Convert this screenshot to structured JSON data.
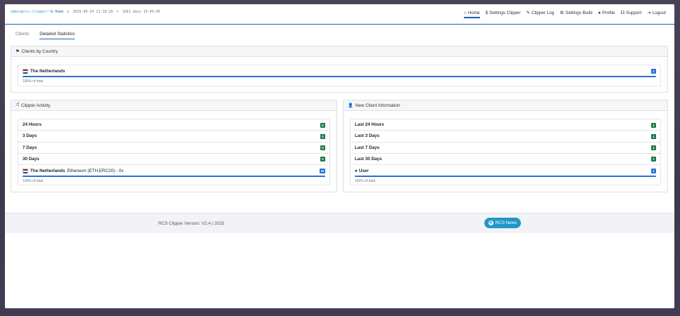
{
  "header": {
    "prompt_user": "admin@rcs-clipper",
    "prompt_path": ":~$ Home",
    "datetime": "2025-09-24 11:10:26",
    "uptime": "1681 days 15:45:45"
  },
  "nav": [
    {
      "icon": "home-icon",
      "label": "Home"
    },
    {
      "icon": "dollar-icon",
      "label": "Settings Clipper"
    },
    {
      "icon": "pencil-icon",
      "label": "Clipper Log"
    },
    {
      "icon": "gear-icon",
      "label": "Settings Build"
    },
    {
      "icon": "user-icon",
      "label": "Profile"
    },
    {
      "icon": "headset-icon",
      "label": "Support"
    },
    {
      "icon": "logout-icon",
      "label": "Logout"
    }
  ],
  "tabs": [
    "Clients",
    "Detailed Statistics"
  ],
  "countries": {
    "title": "Clients by Country",
    "country": "The Netherlands",
    "count": "1",
    "percent_text": "100% of total",
    "fill": 1.0
  },
  "activity": {
    "title": "Clipper Activity",
    "rows": [
      {
        "label": "24 Hours",
        "count": "0"
      },
      {
        "label": "3 Days",
        "count": "0"
      },
      {
        "label": "7 Days",
        "count": "0"
      },
      {
        "label": "30 Days",
        "count": "0"
      }
    ],
    "country": "The Netherlands",
    "detail": "Ethereum (ETH,ERC20) - 0x",
    "detail_count": "32",
    "percent_text": "100% of total",
    "fill": 1.0
  },
  "new_clients": {
    "title": "New Client Information",
    "rows": [
      {
        "label": "Last 24 Hours",
        "count": "1"
      },
      {
        "label": "Last 3 Days",
        "count": "1"
      },
      {
        "label": "Last 7 Days",
        "count": "1"
      },
      {
        "label": "Last 30 Days",
        "count": "1"
      }
    ],
    "user_label": "User",
    "user_count": "1",
    "percent_text": "100% of total",
    "fill": 1.0
  },
  "footer": {
    "version": "RCS Clipper Version: V2.4 | 2025",
    "news_label": "RCS News"
  },
  "colors": {
    "accent": "#1f5fae",
    "badge_green": "#1f7a47",
    "badge_blue": "#2e6fd6",
    "news_button": "#2196c8"
  }
}
